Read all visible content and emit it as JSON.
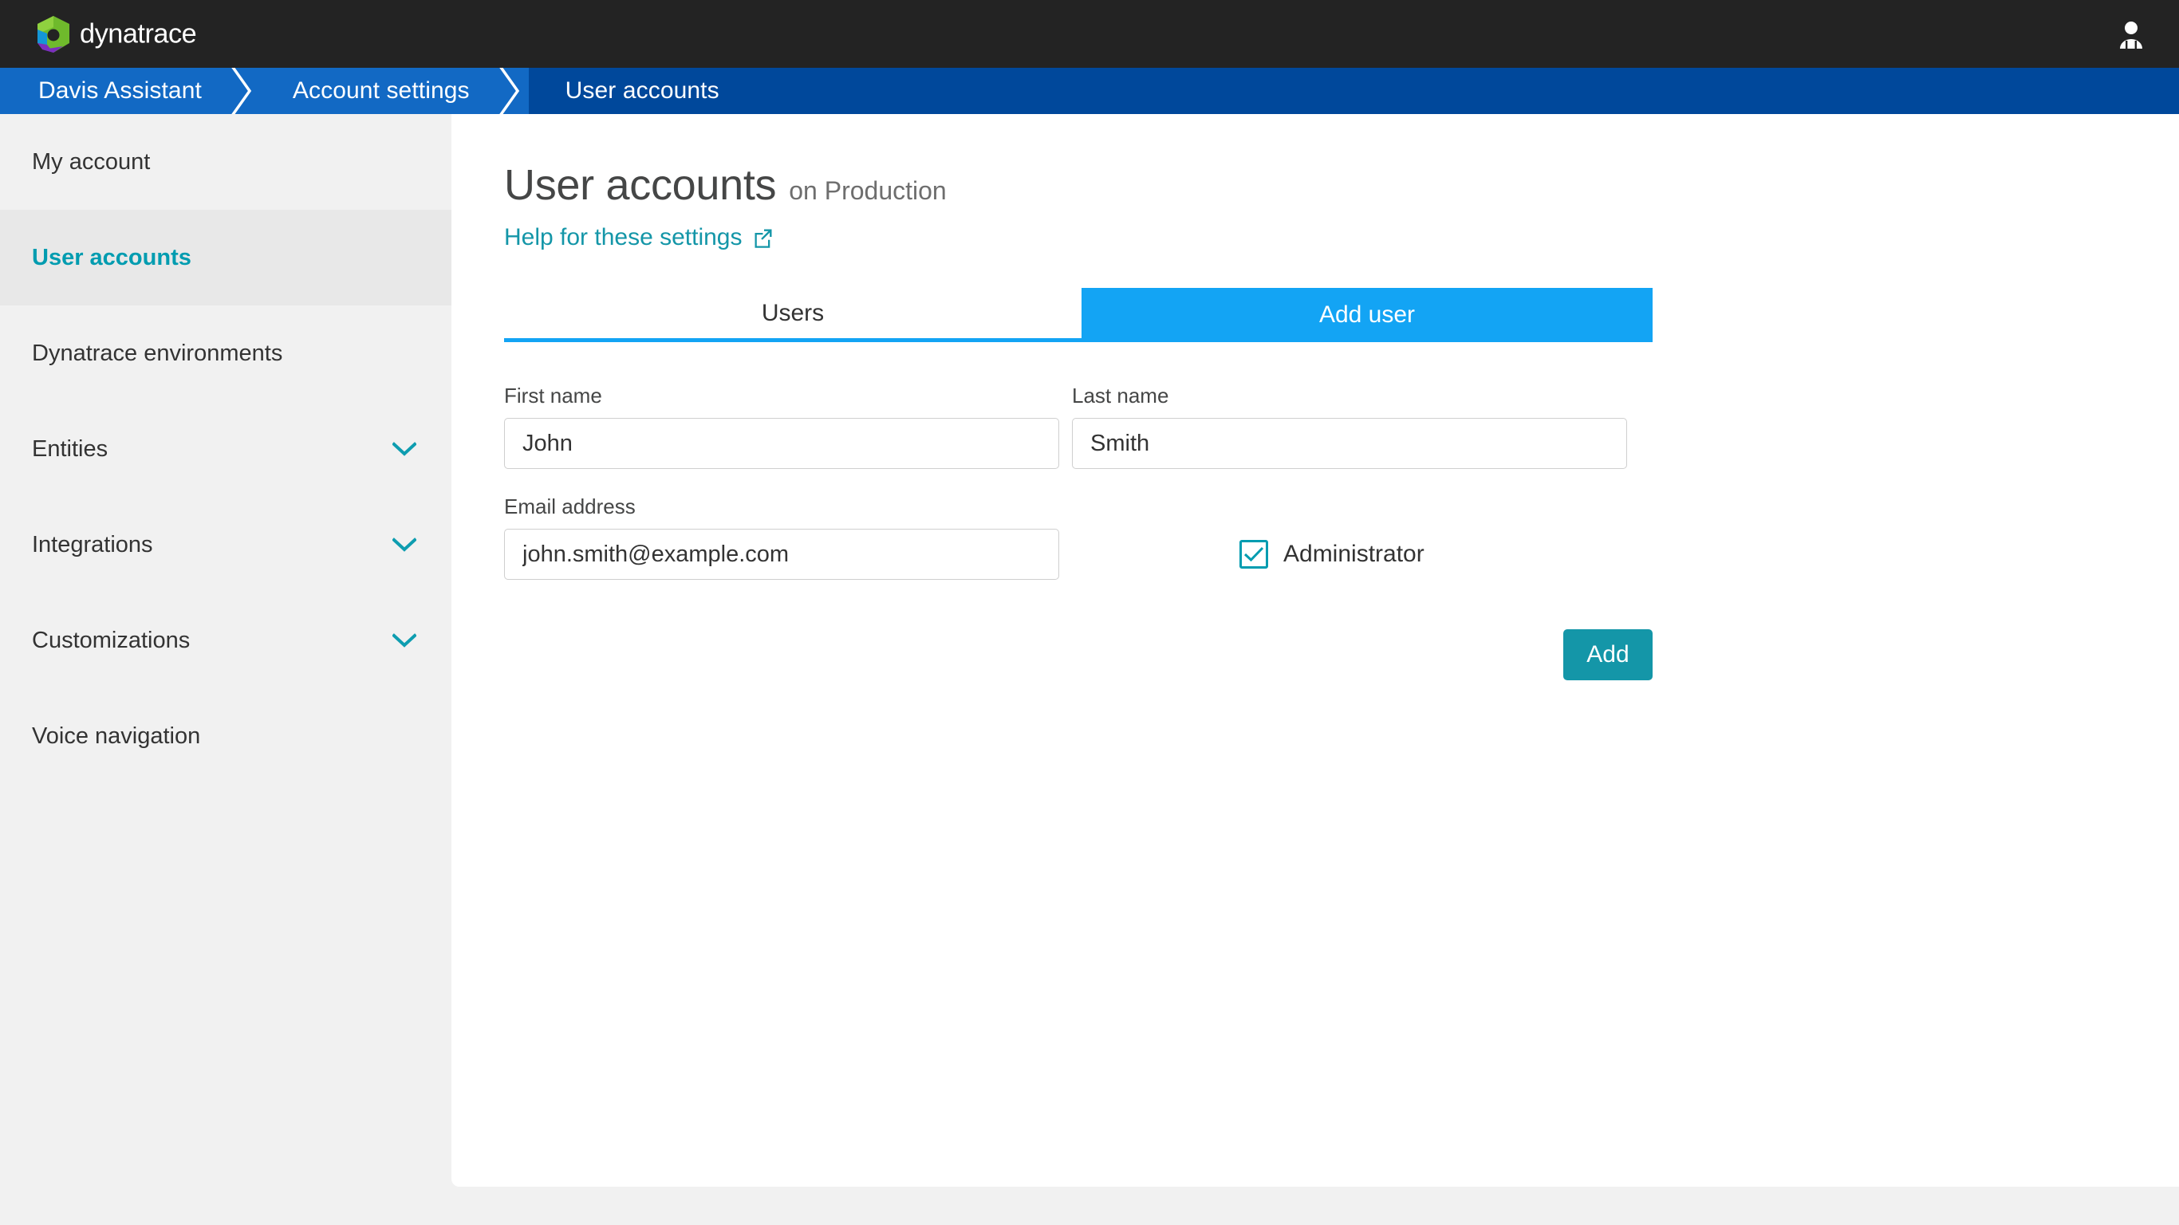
{
  "colors": {
    "header_bg": "#232323",
    "breadcrumb_bg": "#1269c4",
    "breadcrumb_active_bg": "#00489b",
    "sidebar_bg": "#f1f1f1",
    "sidebar_active_bg": "#e8e8e8",
    "accent_teal": "#009cb0",
    "accent_blue": "#13a4f4",
    "link_teal": "#1496a8",
    "page_bg": "#f1f1f1"
  },
  "header": {
    "logo_name": "dynatrace",
    "logo_text": "dynatrace",
    "avatar_icon": "user-icon"
  },
  "breadcrumb": {
    "items": [
      {
        "label": "Davis Assistant",
        "active": false
      },
      {
        "label": "Account settings",
        "active": false
      },
      {
        "label": "User accounts",
        "active": true
      }
    ],
    "separator_icon": "chevron-right-icon"
  },
  "sidebar": {
    "items": [
      {
        "label": "My account",
        "active": false,
        "expandable": false
      },
      {
        "label": "User accounts",
        "active": true,
        "expandable": false
      },
      {
        "label": "Dynatrace environments",
        "active": false,
        "expandable": false
      },
      {
        "label": "Entities",
        "active": false,
        "expandable": true
      },
      {
        "label": "Integrations",
        "active": false,
        "expandable": true
      },
      {
        "label": "Customizations",
        "active": false,
        "expandable": true
      },
      {
        "label": "Voice navigation",
        "active": false,
        "expandable": false
      }
    ],
    "chevron_icon": "chevron-down-icon"
  },
  "main": {
    "title": "User accounts",
    "title_suffix": "on Production",
    "help_link": "Help for these settings",
    "help_link_icon": "external-link-icon",
    "tabs": [
      {
        "label": "Users",
        "type": "tab",
        "selected": true
      },
      {
        "label": "Add user",
        "type": "button",
        "selected": false
      }
    ],
    "form": {
      "first_name": {
        "label": "First name",
        "value": "John",
        "placeholder": "First name"
      },
      "last_name": {
        "label": "Last name",
        "value": "Smith",
        "placeholder": "Last name"
      },
      "email": {
        "label": "Email address",
        "value": "john.smith@example.com",
        "placeholder": "Email address"
      },
      "administrator": {
        "label": "Administrator",
        "checked": true,
        "check_icon": "checkmark-icon"
      },
      "submit_label": "Add"
    }
  }
}
